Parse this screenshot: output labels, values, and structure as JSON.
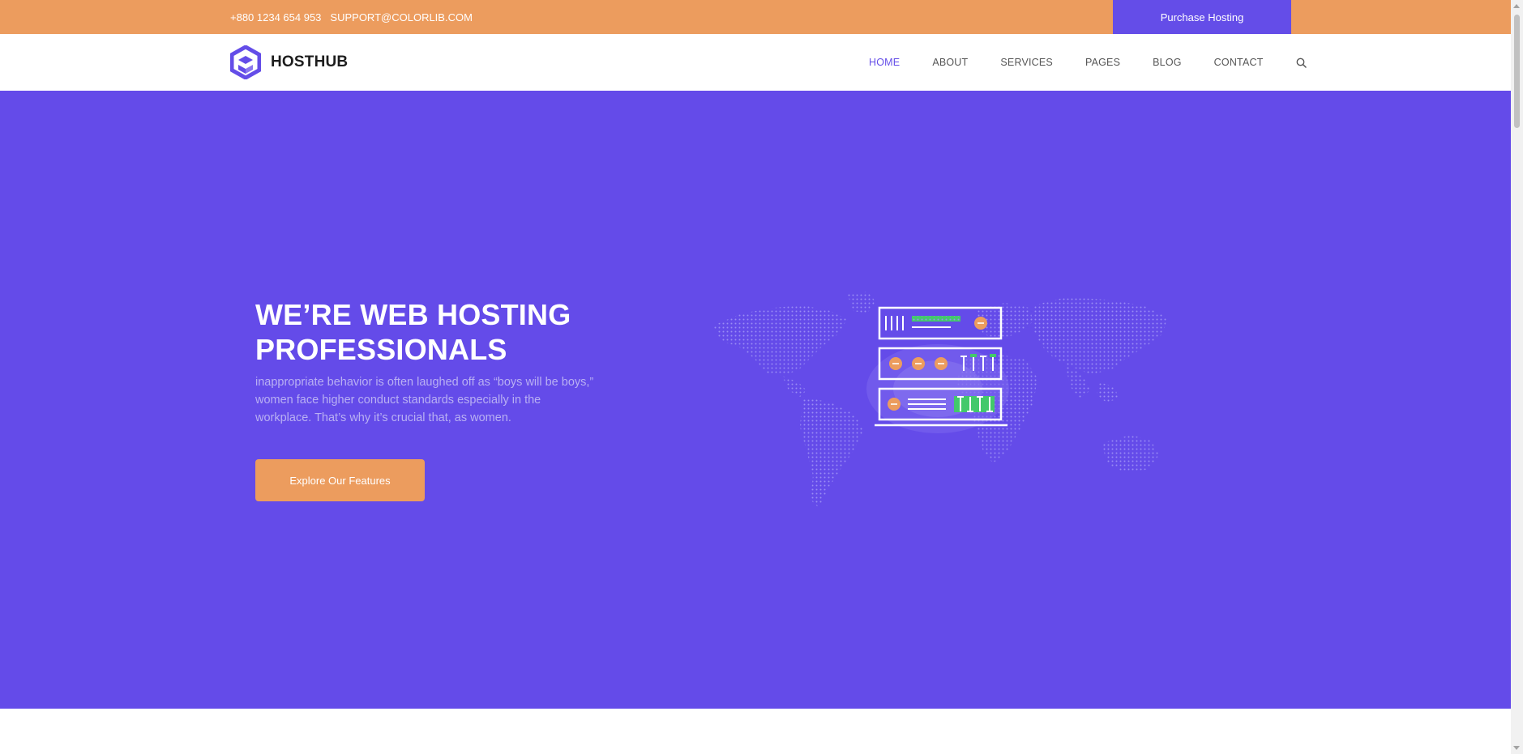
{
  "topbar": {
    "phone": "+880 1234 654 953",
    "email": "SUPPORT@COLORLIB.COM",
    "purchase_label": "Purchase Hosting"
  },
  "brand": {
    "name": "HOSTHUB"
  },
  "nav": {
    "items": [
      {
        "label": "HOME",
        "active": true
      },
      {
        "label": "ABOUT",
        "active": false
      },
      {
        "label": "SERVICES",
        "active": false
      },
      {
        "label": "PAGES",
        "active": false
      },
      {
        "label": "BLOG",
        "active": false
      },
      {
        "label": "CONTACT",
        "active": false
      }
    ],
    "search_icon": "search-icon"
  },
  "hero": {
    "title_line1": "WE’RE WEB HOSTING",
    "title_line2": "PROFESSIONALS",
    "text": "inappropriate behavior is often laughed off as “boys will be boys,” women face higher conduct standards especially in the workplace. That’s why it’s crucial that, as women.",
    "cta_label": "Explore Our Features",
    "illustration_icon": "server-world-map-illustration"
  },
  "colors": {
    "accent_orange": "#ec9c5e",
    "brand_purple": "#644be9",
    "nav_active": "#644de8"
  }
}
